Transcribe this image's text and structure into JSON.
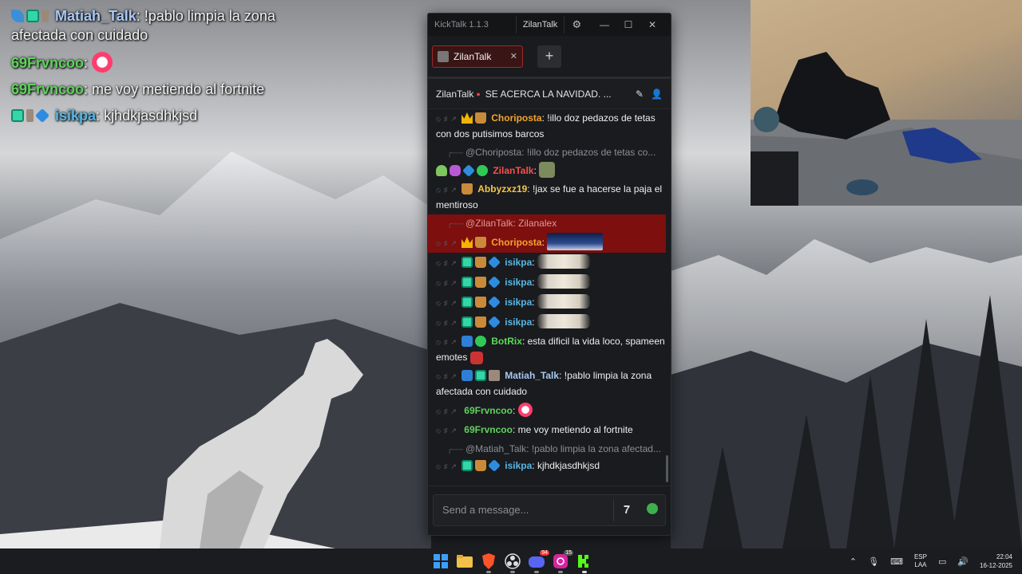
{
  "overlay_chat": [
    {
      "badges": [
        "blade",
        "og",
        "tool"
      ],
      "name": "Matiah_Talk",
      "name_color": "#a9c8f5",
      "text": "!pablo limpia la zona afectada con cuidado"
    },
    {
      "badges": [],
      "name": "69Frvncoo",
      "name_color": "#5fd35c",
      "emote": "circle-emote"
    },
    {
      "badges": [],
      "name": "69Frvncoo",
      "name_color": "#5fd35c",
      "text": "me voy metiendo al fortnite"
    },
    {
      "badges": [
        "og",
        "tool",
        "vip"
      ],
      "name": "isikpa",
      "name_color": "#56b8e6",
      "text": "kjhdkjasdhkjsd"
    }
  ],
  "kicktalk": {
    "app_title": "KickTalk 1.1.3",
    "user": "ZilanTalk",
    "tab_label": "ZilanTalk",
    "channel_name": "ZilanTalk",
    "stream_title": "SE ACERCA LA NAVIDAD. ...",
    "input_placeholder": "Send a message...",
    "colors": {
      "accent_red": "#9e2a2a",
      "highlight": "#7d0f0f",
      "live": "#ff3b3b"
    },
    "messages": [
      {
        "type": "msg",
        "badges": [
          "crown",
          "cup"
        ],
        "name": "Choriposta",
        "color": "#f4a42e",
        "text": "!illo doz pedazos de tetas con dos putisimos barcos"
      },
      {
        "type": "reply",
        "text": "@Choriposta: !illo doz pedazos de tetas co..."
      },
      {
        "type": "msg",
        "badges": [
          "droid",
          "mic",
          "vip",
          "check"
        ],
        "name": "ZilanTalk",
        "color": "#ff4d4d",
        "emote": "small",
        "text": ""
      },
      {
        "type": "msg",
        "badges": [
          "cup"
        ],
        "name": "Abbyzxz19",
        "color": "#f4c64a",
        "text": "!jax se fue a hacerse la paja el mentiroso"
      },
      {
        "type": "reply",
        "hl": true,
        "text": "@ZilanTalk: Zilanalex"
      },
      {
        "type": "msg",
        "hl": true,
        "badges": [
          "crown",
          "cup"
        ],
        "name": "Choriposta",
        "color": "#f4a42e",
        "emote": "pic",
        "text": ""
      },
      {
        "type": "msg",
        "badges": [
          "og",
          "cup",
          "vip"
        ],
        "name": "isikpa",
        "color": "#56b8e6",
        "emote": "wide",
        "text": ""
      },
      {
        "type": "msg",
        "badges": [
          "og",
          "cup",
          "vip"
        ],
        "name": "isikpa",
        "color": "#56b8e6",
        "emote": "wide",
        "text": ""
      },
      {
        "type": "msg",
        "badges": [
          "og",
          "cup",
          "vip"
        ],
        "name": "isikpa",
        "color": "#56b8e6",
        "emote": "wide",
        "text": ""
      },
      {
        "type": "msg",
        "badges": [
          "og",
          "cup",
          "vip"
        ],
        "name": "isikpa",
        "color": "#56b8e6",
        "emote": "wide",
        "text": ""
      },
      {
        "type": "msg",
        "badges": [
          "hammer",
          "check"
        ],
        "name": "BotRix",
        "color": "#5ed85a",
        "text": "esta dificil la vida loco, spameen emotes",
        "emote": "small"
      },
      {
        "type": "msg",
        "badges": [
          "hammer",
          "og",
          "tool"
        ],
        "name": "Matiah_Talk",
        "color": "#a9c8f5",
        "text": "!pablo limpia la zona afectada con cuidado"
      },
      {
        "type": "msg",
        "badges": [],
        "name": "69Frvncoo",
        "color": "#5fd35c",
        "emote": "circle",
        "text": ""
      },
      {
        "type": "msg",
        "badges": [],
        "name": "69Frvncoo",
        "color": "#5fd35c",
        "text": "me voy metiendo al fortnite"
      },
      {
        "type": "reply",
        "text": "@Matiah_Talk: !pablo limpia la zona afectad..."
      },
      {
        "type": "msg",
        "badges": [
          "og",
          "cup",
          "vip"
        ],
        "name": "isikpa",
        "color": "#56b8e6",
        "text": "kjhdkjasdhkjsd"
      }
    ]
  },
  "taskbar": {
    "apps": [
      "windows-start-icon",
      "file-explorer-icon",
      "brave-browser-icon",
      "obs-icon",
      "discord-icon",
      "instagram-icon",
      "kick-icon"
    ],
    "discord_badge": "94",
    "instagram_badge": "15",
    "language": "ESP",
    "language_sub": "LAA",
    "time": "22:04",
    "date": "16-12-2025"
  }
}
